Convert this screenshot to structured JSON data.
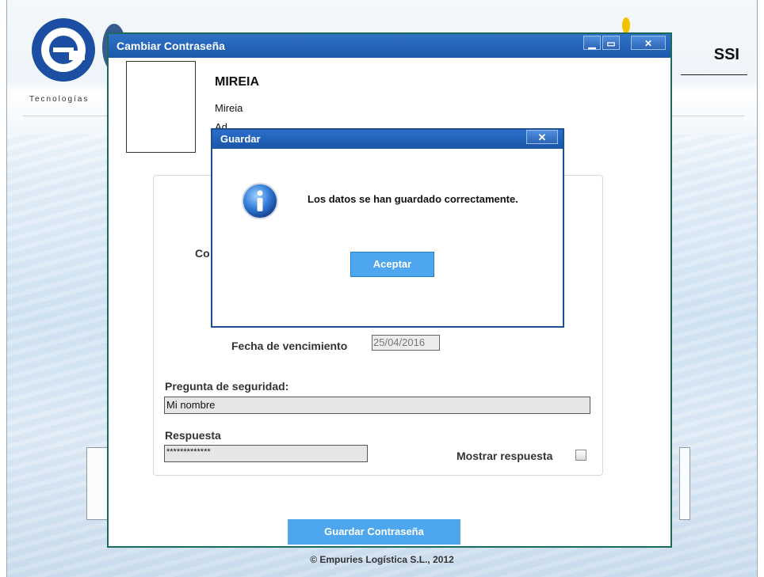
{
  "app": {
    "logo_text": "Tecnologías",
    "brand_right": "SSI",
    "footer": "© Empuries Logística S.L., 2012"
  },
  "window": {
    "title": "Cambiar Contraseña",
    "min_icon": "minimize-icon",
    "max_icon": "maximize-icon",
    "close_icon": "close-icon"
  },
  "user": {
    "username": "MIREIA",
    "full_name": "Mireia",
    "role_partial": "Ad"
  },
  "form": {
    "partial_label": "Co",
    "expiry_label": "Fecha de vencimiento",
    "expiry_value": "25/04/2016",
    "security_question_label": "Pregunta de seguridad:",
    "security_question_value": "Mi nombre",
    "answer_label": "Respuesta",
    "answer_value": "*************",
    "show_answer_label": "Mostrar respuesta",
    "show_answer_checked": false,
    "save_button": "Guardar Contraseña"
  },
  "modal": {
    "title": "Guardar",
    "close_icon": "close-icon",
    "icon": "info-icon",
    "message": "Los datos se han guardado correctamente.",
    "ok_button": "Aceptar"
  }
}
